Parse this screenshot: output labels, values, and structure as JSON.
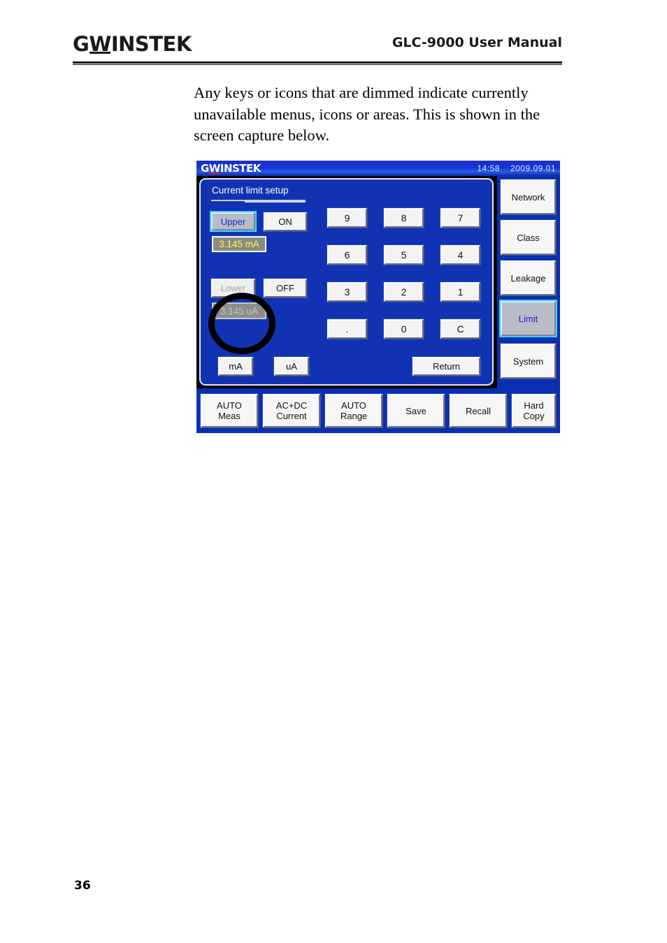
{
  "page": {
    "number": "36",
    "brand_logo_pre": "G",
    "brand_logo_w": "W",
    "brand_logo_post": "INSTEK",
    "manual_title": "GLC-9000 User Manual",
    "paragraph": "Any keys or icons that are dimmed indicate currently unavailable menus, icons or areas. This is shown in the screen capture below."
  },
  "device": {
    "logo_pre": "G",
    "logo_w": "W",
    "logo_post": "INSTEK",
    "time": "14:58",
    "date": "2009.09.01",
    "panel_title": "Current limit setup",
    "upper": {
      "label": "Upper",
      "state_label": "ON",
      "value": "3.145 mA"
    },
    "lower": {
      "label": "Lower",
      "state_label": "OFF",
      "value": "3.145 uA"
    },
    "keypad": [
      {
        "key": "9"
      },
      {
        "key": "8"
      },
      {
        "key": "7"
      },
      {
        "key": "6"
      },
      {
        "key": "5"
      },
      {
        "key": "4"
      },
      {
        "key": "3"
      },
      {
        "key": "2"
      },
      {
        "key": "1"
      },
      {
        "key": "."
      },
      {
        "key": "0"
      },
      {
        "key": "C"
      }
    ],
    "unit_buttons": [
      {
        "label": "mA"
      },
      {
        "label": "uA"
      }
    ],
    "return_label": "Return",
    "sidebar": [
      {
        "label": "Network",
        "selected": false
      },
      {
        "label": "Class",
        "selected": false
      },
      {
        "label": "Leakage",
        "selected": false
      },
      {
        "label": "Limit",
        "selected": true
      },
      {
        "label": "System",
        "selected": false
      }
    ],
    "bottombar": [
      {
        "line1": "AUTO",
        "line2": "Meas"
      },
      {
        "line1": "AC+DC",
        "line2": "Current"
      },
      {
        "line1": "AUTO",
        "line2": "Range"
      },
      {
        "line1": "Save",
        "line2": ""
      },
      {
        "line1": "Recall",
        "line2": ""
      },
      {
        "line1": "Hard",
        "line2": "Copy"
      }
    ],
    "colors": {
      "screen_blue": "#0b2fb0",
      "panel_blue": "#1133b3",
      "selected_text": "#2020cc",
      "selected_glow": "#35d4ff",
      "value_yellow": "#ffff33",
      "dimmed_text": "#a8a8a8",
      "logo_accent_red": "#e02020"
    }
  }
}
